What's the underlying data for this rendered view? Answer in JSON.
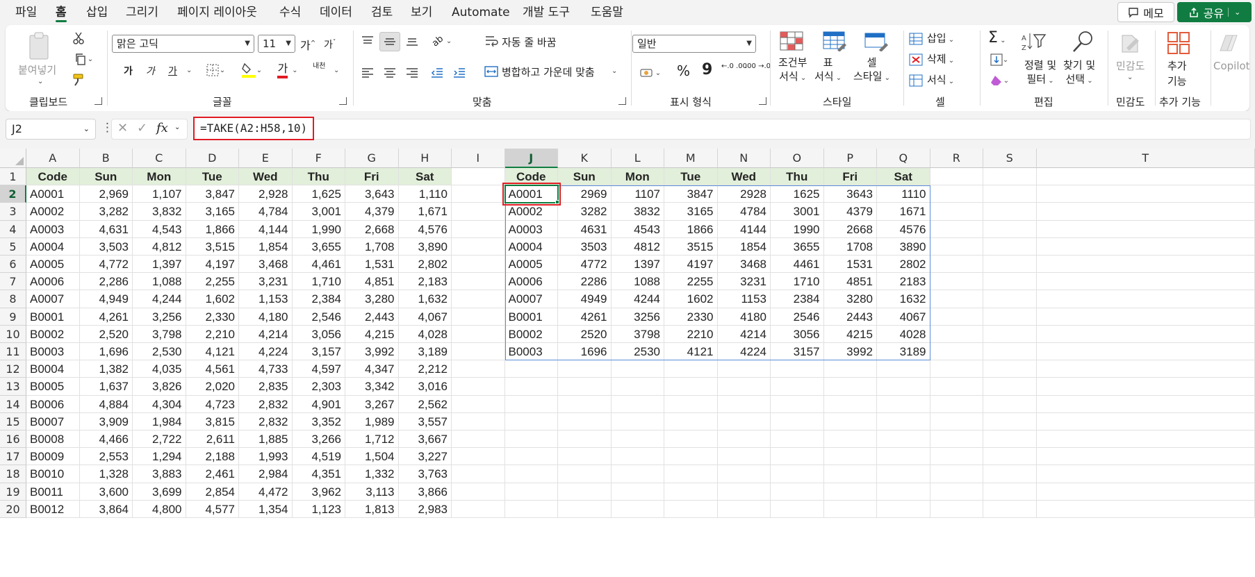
{
  "menu": {
    "items": [
      "파일",
      "홈",
      "삽입",
      "그리기",
      "페이지 레이아웃",
      "수식",
      "데이터",
      "검토",
      "보기",
      "Automate",
      "개발 도구",
      "도움말"
    ],
    "active": "홈",
    "memo_label": "메모",
    "share_label": "공유"
  },
  "ribbon": {
    "clipboard": {
      "paste": "붙여넣기",
      "label": "클립보드"
    },
    "font": {
      "name": "맑은 고딕",
      "size": "11",
      "label": "글꼴",
      "grow": "가",
      "shrink": "가",
      "bold": "가",
      "italic": "가",
      "underline": "가",
      "fontcolor": "가",
      "phonetic": "내천"
    },
    "alignment": {
      "wrap": "자동 줄 바꿈",
      "merge": "병합하고 가운데 맞춤",
      "label": "맞춤"
    },
    "number": {
      "format": "일반",
      "percent": "%",
      "comma": "9",
      "inc": "←.0 .00",
      "dec": ".00 →.0",
      "label": "표시 형식"
    },
    "styles": {
      "conditional": [
        "조건부",
        "서식"
      ],
      "table": [
        "표",
        "서식"
      ],
      "cell": [
        "셀",
        "스타일"
      ],
      "label": "스타일"
    },
    "cells": {
      "insert": "삽입",
      "delete": "삭제",
      "format": "서식",
      "label": "셀"
    },
    "editing": {
      "sort": [
        "정렬 및",
        "필터"
      ],
      "find": [
        "찾기 및",
        "선택"
      ],
      "label": "편집"
    },
    "sensitivity": {
      "button": "민감도",
      "label": "민감도"
    },
    "addins": {
      "button": [
        "추가",
        "기능"
      ],
      "label": "추가 기능"
    },
    "copilot": "Copilot"
  },
  "formula_bar": {
    "name_box": "J2",
    "fx": "fx",
    "formula": "=TAKE(A2:H58,10)"
  },
  "sheet": {
    "columns": [
      "A",
      "B",
      "C",
      "D",
      "E",
      "F",
      "G",
      "H",
      "I",
      "J",
      "K",
      "L",
      "M",
      "N",
      "O",
      "P",
      "Q",
      "R",
      "S",
      "T"
    ],
    "selected_column": "J",
    "selected_row": 2,
    "rows": [
      1,
      2,
      3,
      4,
      5,
      6,
      7,
      8,
      9,
      10,
      11,
      12,
      13,
      14,
      15,
      16,
      17,
      18,
      19,
      20
    ],
    "headers": [
      "Code",
      "Sun",
      "Mon",
      "Tue",
      "Wed",
      "Thu",
      "Fri",
      "Sat"
    ],
    "source": [
      [
        "A0001",
        "2,969",
        "1,107",
        "3,847",
        "2,928",
        "1,625",
        "3,643",
        "1,110"
      ],
      [
        "A0002",
        "3,282",
        "3,832",
        "3,165",
        "4,784",
        "3,001",
        "4,379",
        "1,671"
      ],
      [
        "A0003",
        "4,631",
        "4,543",
        "1,866",
        "4,144",
        "1,990",
        "2,668",
        "4,576"
      ],
      [
        "A0004",
        "3,503",
        "4,812",
        "3,515",
        "1,854",
        "3,655",
        "1,708",
        "3,890"
      ],
      [
        "A0005",
        "4,772",
        "1,397",
        "4,197",
        "3,468",
        "4,461",
        "1,531",
        "2,802"
      ],
      [
        "A0006",
        "2,286",
        "1,088",
        "2,255",
        "3,231",
        "1,710",
        "4,851",
        "2,183"
      ],
      [
        "A0007",
        "4,949",
        "4,244",
        "1,602",
        "1,153",
        "2,384",
        "3,280",
        "1,632"
      ],
      [
        "B0001",
        "4,261",
        "3,256",
        "2,330",
        "4,180",
        "2,546",
        "2,443",
        "4,067"
      ],
      [
        "B0002",
        "2,520",
        "3,798",
        "2,210",
        "4,214",
        "3,056",
        "4,215",
        "4,028"
      ],
      [
        "B0003",
        "1,696",
        "2,530",
        "4,121",
        "4,224",
        "3,157",
        "3,992",
        "3,189"
      ],
      [
        "B0004",
        "1,382",
        "4,035",
        "4,561",
        "4,733",
        "4,597",
        "4,347",
        "2,212"
      ],
      [
        "B0005",
        "1,637",
        "3,826",
        "2,020",
        "2,835",
        "2,303",
        "3,342",
        "3,016"
      ],
      [
        "B0006",
        "4,884",
        "4,304",
        "4,723",
        "2,832",
        "4,901",
        "3,267",
        "2,562"
      ],
      [
        "B0007",
        "3,909",
        "1,984",
        "3,815",
        "2,832",
        "3,352",
        "1,989",
        "3,557"
      ],
      [
        "B0008",
        "4,466",
        "2,722",
        "2,611",
        "1,885",
        "3,266",
        "1,712",
        "3,667"
      ],
      [
        "B0009",
        "2,553",
        "1,294",
        "2,188",
        "1,993",
        "4,519",
        "1,504",
        "3,227"
      ],
      [
        "B0010",
        "1,328",
        "3,883",
        "2,461",
        "2,984",
        "4,351",
        "1,332",
        "3,763"
      ],
      [
        "B0011",
        "3,600",
        "3,699",
        "2,854",
        "4,472",
        "3,962",
        "3,113",
        "3,866"
      ],
      [
        "B0012",
        "3,864",
        "4,800",
        "4,577",
        "1,354",
        "1,123",
        "1,813",
        "2,983"
      ]
    ],
    "result": [
      [
        "A0001",
        "2969",
        "1107",
        "3847",
        "2928",
        "1625",
        "3643",
        "1110"
      ],
      [
        "A0002",
        "3282",
        "3832",
        "3165",
        "4784",
        "3001",
        "4379",
        "1671"
      ],
      [
        "A0003",
        "4631",
        "4543",
        "1866",
        "4144",
        "1990",
        "2668",
        "4576"
      ],
      [
        "A0004",
        "3503",
        "4812",
        "3515",
        "1854",
        "3655",
        "1708",
        "3890"
      ],
      [
        "A0005",
        "4772",
        "1397",
        "4197",
        "3468",
        "4461",
        "1531",
        "2802"
      ],
      [
        "A0006",
        "2286",
        "1088",
        "2255",
        "3231",
        "1710",
        "4851",
        "2183"
      ],
      [
        "A0007",
        "4949",
        "4244",
        "1602",
        "1153",
        "2384",
        "3280",
        "1632"
      ],
      [
        "B0001",
        "4261",
        "3256",
        "2330",
        "4180",
        "2546",
        "2443",
        "4067"
      ],
      [
        "B0002",
        "2520",
        "3798",
        "2210",
        "4214",
        "3056",
        "4215",
        "4028"
      ],
      [
        "B0003",
        "1696",
        "2530",
        "4121",
        "4224",
        "3157",
        "3992",
        "3189"
      ]
    ]
  },
  "colors": {
    "accent": "#107c41",
    "header_fill": "#e2efda",
    "highlight": "#e11b22",
    "spill_border": "#5b8ed6"
  }
}
